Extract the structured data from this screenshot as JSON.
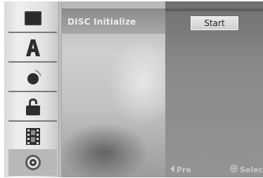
{
  "sidebar": {
    "items": [
      {
        "icon": "monitor-icon"
      },
      {
        "icon": "letter-a-icon"
      },
      {
        "icon": "audio-speaker-icon"
      },
      {
        "icon": "lock-icon"
      },
      {
        "icon": "film-strip-icon"
      },
      {
        "icon": "disc-icon",
        "selected": true
      }
    ]
  },
  "main": {
    "title": "DISC Initialize",
    "start_label": "Start"
  },
  "footer": {
    "prev_label": "Pre",
    "select_label": "Selec"
  },
  "colors": {
    "panel_background": "#8a8a8a",
    "sidebar_background": "#e2e2e2",
    "button_background": "#dcdcdc"
  }
}
